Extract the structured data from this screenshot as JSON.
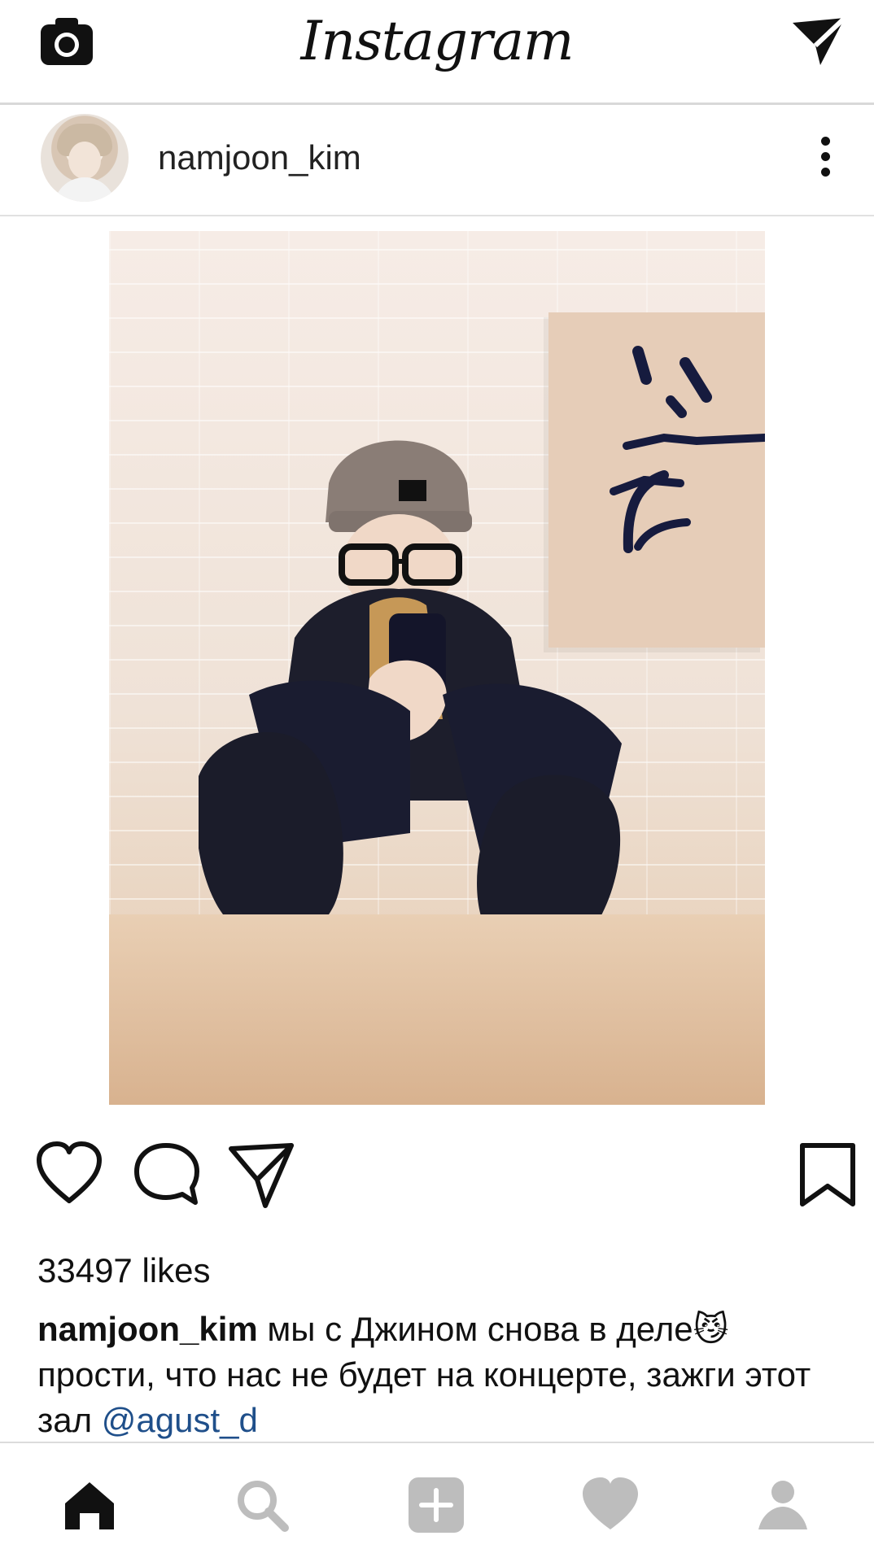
{
  "header": {
    "title": "Instagram",
    "camera_icon": "camera-icon",
    "direct_icon": "send-icon"
  },
  "post": {
    "username": "namjoon_kim",
    "avatar": "avatar",
    "more_icon": "more-vertical-icon",
    "likes_text": "33497 likes",
    "caption_user": "namjoon_kim",
    "caption_text": " мы с Джином снова в деле😼 прости, что нас не будет на концерте, зажги этот зал ",
    "mention": "@agust_d"
  },
  "actions": {
    "like_icon": "heart-outline-icon",
    "comment_icon": "comment-icon",
    "share_icon": "send-icon",
    "save_icon": "bookmark-icon"
  },
  "bottom_nav": {
    "items": [
      "home-icon",
      "search-icon",
      "add-icon",
      "heart-icon",
      "profile-icon"
    ]
  },
  "colors": {
    "brand_text": "#111111",
    "link": "#1f4f8a",
    "divider": "#d9d9d9",
    "icon_active": "#111111",
    "icon_inactive": "#bdbdbd"
  }
}
